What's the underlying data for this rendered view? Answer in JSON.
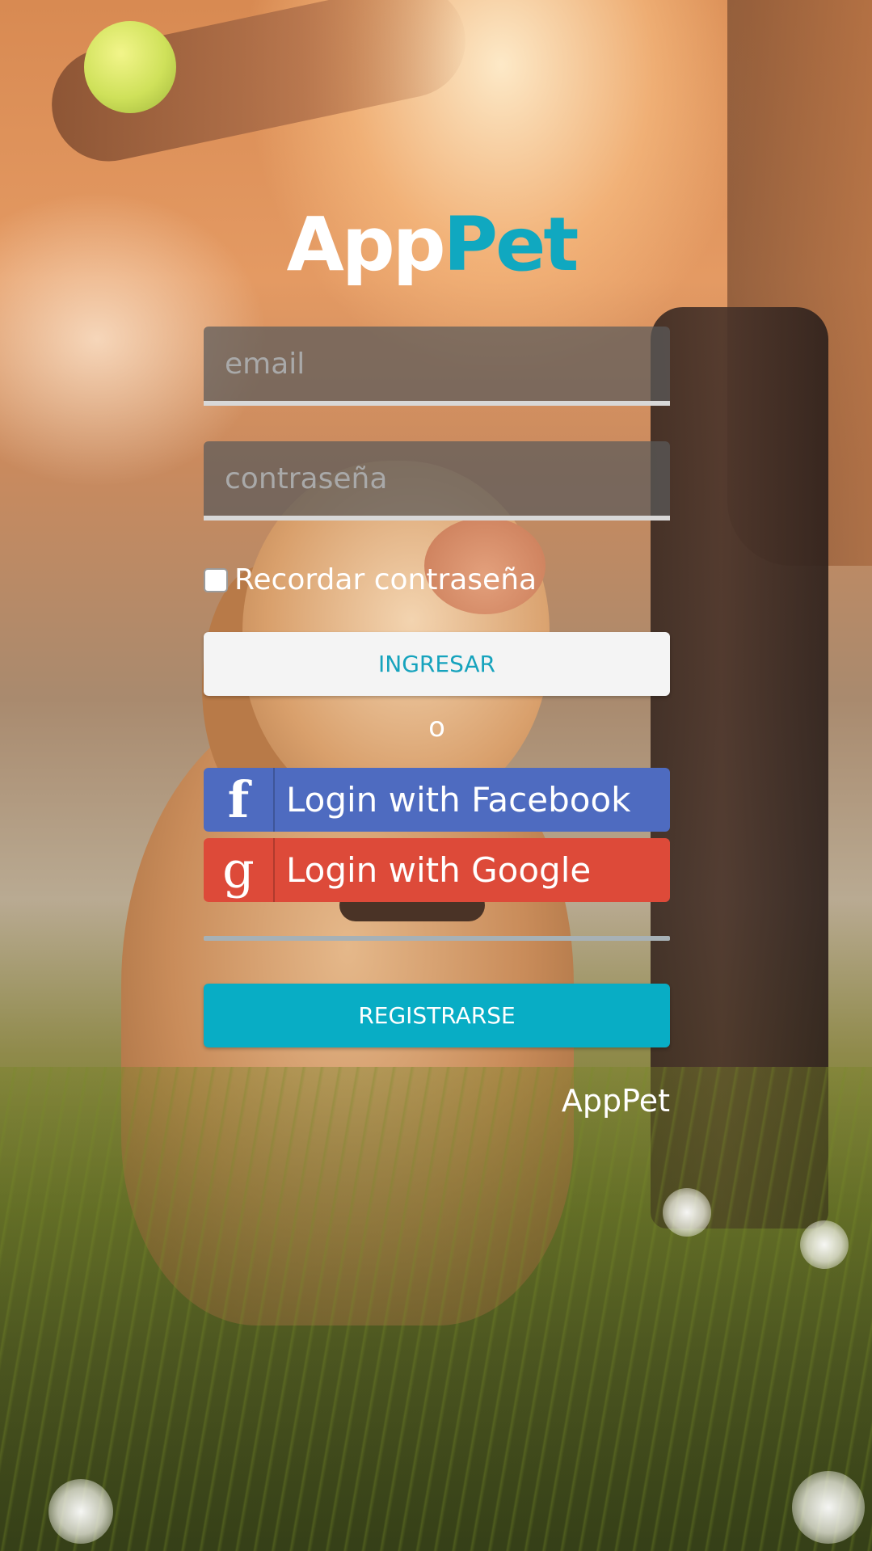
{
  "logo": {
    "part1": "App",
    "part2": "Pet",
    "colors": {
      "part1": "#ffffff",
      "part2": "#10a8c0"
    }
  },
  "form": {
    "email": {
      "placeholder": "email",
      "value": ""
    },
    "password": {
      "placeholder": "contraseña",
      "value": ""
    },
    "remember": {
      "label": "Recordar contraseña",
      "checked": false
    },
    "login_label": "INGRESAR",
    "or_label": "o",
    "register_label": "REGISTRARSE"
  },
  "social": {
    "facebook": {
      "label": "Login with Facebook",
      "icon": "facebook-icon",
      "icon_glyph": "f",
      "color": "#4e6bc0"
    },
    "google": {
      "label": "Login with Google",
      "icon": "google-icon",
      "icon_glyph": "g",
      "color": "#dd4a39"
    }
  },
  "footer": {
    "brand": "AppPet"
  },
  "colors": {
    "accent": "#08adc5",
    "login_text": "#16a3bd"
  }
}
